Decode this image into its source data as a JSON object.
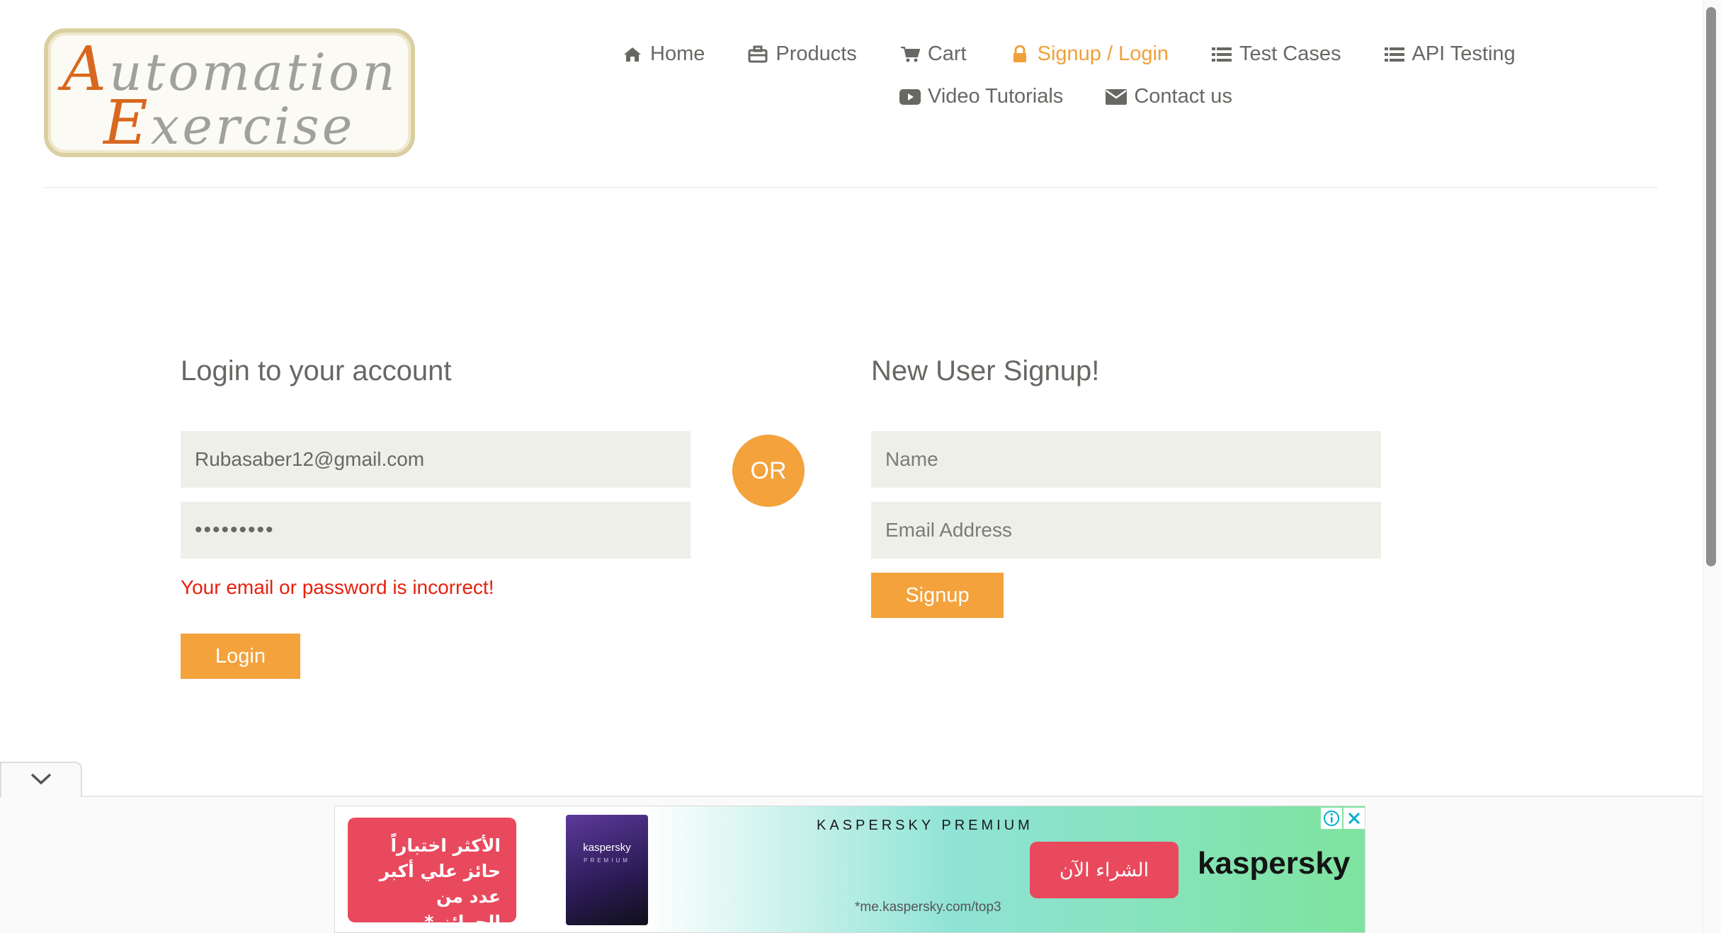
{
  "logo": {
    "line1_cap": "A",
    "line1_rest": "utomation",
    "line2_cap": "E",
    "line2_rest": "xercise"
  },
  "nav": {
    "row1": [
      {
        "label": "Home",
        "icon": "home-icon"
      },
      {
        "label": "Products",
        "icon": "briefcase-icon"
      },
      {
        "label": "Cart",
        "icon": "cart-icon"
      },
      {
        "label": "Signup / Login",
        "icon": "lock-icon",
        "active": true
      },
      {
        "label": "Test Cases",
        "icon": "list-icon"
      },
      {
        "label": "API Testing",
        "icon": "list-icon"
      }
    ],
    "row2": [
      {
        "label": "Video Tutorials",
        "icon": "youtube-play-icon"
      },
      {
        "label": "Contact us",
        "icon": "envelope-icon"
      }
    ],
    "active_color": "#f0a038"
  },
  "login": {
    "heading": "Login to your account",
    "email_value": "Rubasaber12@gmail.com",
    "password_value": "•••••••••",
    "error": "Your email or password is incorrect!",
    "button": "Login"
  },
  "or_label": "OR",
  "signup": {
    "heading": "New User Signup!",
    "name_placeholder": "Name",
    "email_placeholder": "Email Address",
    "button": "Signup"
  },
  "ad": {
    "red_box_text": "الأكثر اختباراً حائز علي أكبر عدد من الجوائز.*",
    "product_brand": "kaspersky",
    "product_sub": "PREMIUM",
    "headline": "KASPERSKY PREMIUM",
    "footnote": "*me.kaspersky.com/top3",
    "cta": "الشراء الآن",
    "logo": "kaspersky"
  },
  "colors": {
    "accent": "#f3a23c",
    "error": "#e8200c",
    "field_bg": "#efefea"
  }
}
